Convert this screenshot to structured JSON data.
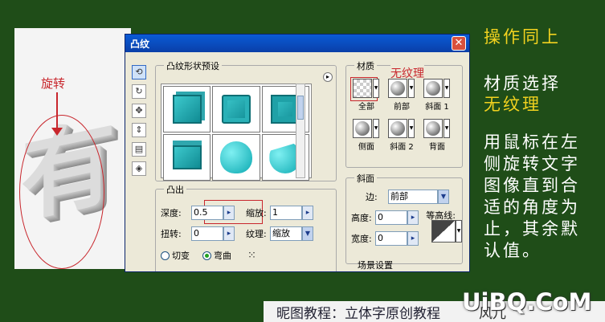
{
  "canvas": {
    "big_char": "有",
    "rotate_label": "旋转"
  },
  "dialog": {
    "title": "凸纹",
    "close_label": "✕",
    "presets": {
      "label": "凸纹形状预设",
      "menu_icon": "▸"
    },
    "extrude": {
      "label": "凸出",
      "depth_label": "深度:",
      "depth_value": "0.5",
      "scale_label": "缩放:",
      "scale_value": "1",
      "twist_label": "扭转:",
      "twist_value": "0",
      "texture_label": "纹理:",
      "texture_value": "缩放",
      "radio_taper": "切变",
      "radio_bend": "弯曲"
    },
    "material": {
      "label": "材质",
      "callout": "无纹理",
      "items": [
        "全部",
        "前部",
        "斜面 1",
        "侧面",
        "斜面 2",
        "背面"
      ]
    },
    "bevel": {
      "label": "斜面",
      "side_label": "边:",
      "side_value": "前部",
      "height_label": "高度:",
      "height_value": "0",
      "contour_label": "等高线:",
      "width_label": "宽度:",
      "width_value": "0",
      "partial_label": "场景设置"
    }
  },
  "side": {
    "title": "操作同上",
    "material": "材质选择",
    "notexture": "无纹理",
    "desc": "用鼠标在左侧旋转文字图像直到合适的角度为止，其余默认值。"
  },
  "footer": {
    "text": "昵图教程：立体字原创教程",
    "author": "风儿",
    "watermark": "UiBQ.CoM"
  },
  "colors": {
    "background": "#1f4d18",
    "accent_yellow": "#f2d21f",
    "annotation_red": "#c8262c",
    "titlebar_blue": "#0a5bd6"
  }
}
